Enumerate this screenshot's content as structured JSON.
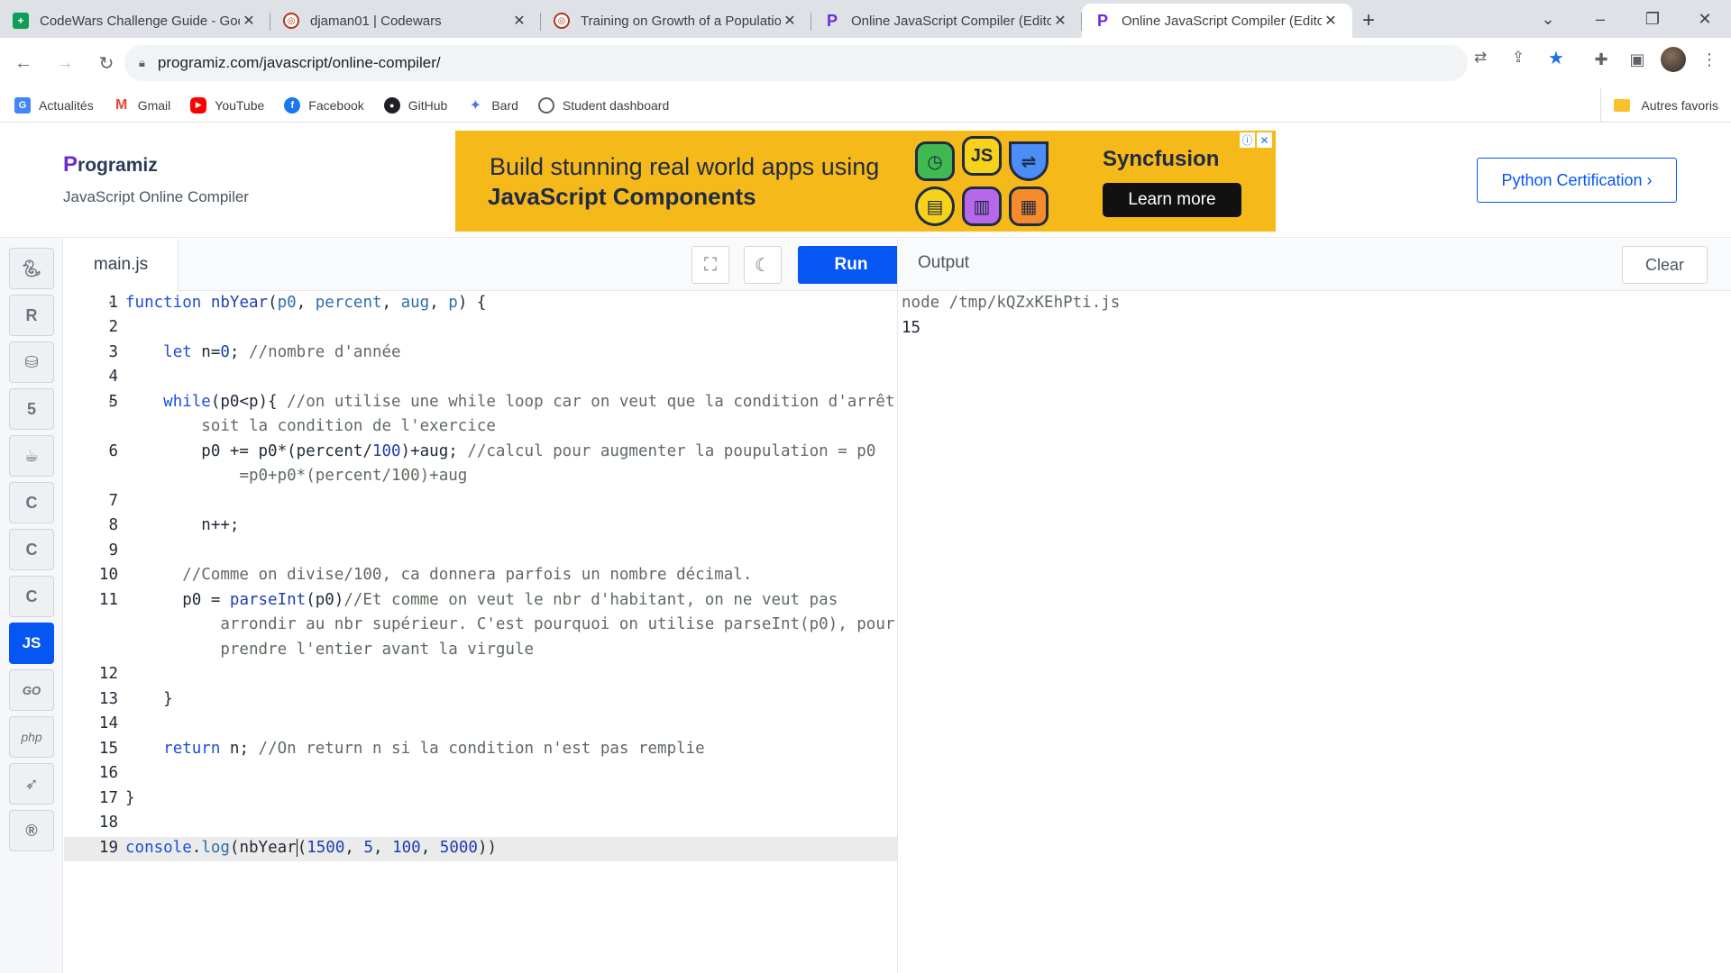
{
  "browser": {
    "tabs": [
      {
        "title": "CodeWars Challenge Guide - Goo",
        "icon": "sheets-icon",
        "active": false
      },
      {
        "title": "djaman01 | Codewars",
        "icon": "codewars-icon",
        "active": false
      },
      {
        "title": "Training on Growth of a Populatio",
        "icon": "codewars-icon",
        "active": false
      },
      {
        "title": "Online JavaScript Compiler (Edito",
        "icon": "programiz-icon",
        "active": false
      },
      {
        "title": "Online JavaScript Compiler (Edito",
        "icon": "programiz-icon",
        "active": true
      }
    ],
    "url": "programiz.com/javascript/online-compiler/",
    "bookmarks": [
      "Actualités",
      "Gmail",
      "YouTube",
      "Facebook",
      "GitHub",
      "Bard",
      "Student dashboard"
    ],
    "other_bookmarks": "Autres favoris"
  },
  "header": {
    "logo": "rogramiz",
    "logo_initial": "P",
    "subtitle": "JavaScript Online Compiler",
    "cert_button": "Python Certification ›"
  },
  "ad": {
    "line1": "Build stunning real world apps using",
    "line2": "JavaScript Components",
    "brand": "Syncfusion",
    "cta": "Learn more",
    "js_badge": "JS"
  },
  "rail": {
    "active": "JS",
    "labels": {
      "go": "GO",
      "php": "php",
      "js": "JS"
    }
  },
  "editor": {
    "file_name": "main.js",
    "run_label": "Run"
  },
  "output": {
    "title": "Output",
    "clear_label": "Clear",
    "lines": [
      "node /tmp/kQZxKEhPti.js",
      "15"
    ]
  },
  "colors": {
    "accent": "#0556f3",
    "ad_bg": "#f6b91a",
    "brand_purple": "#6c2bd9"
  }
}
